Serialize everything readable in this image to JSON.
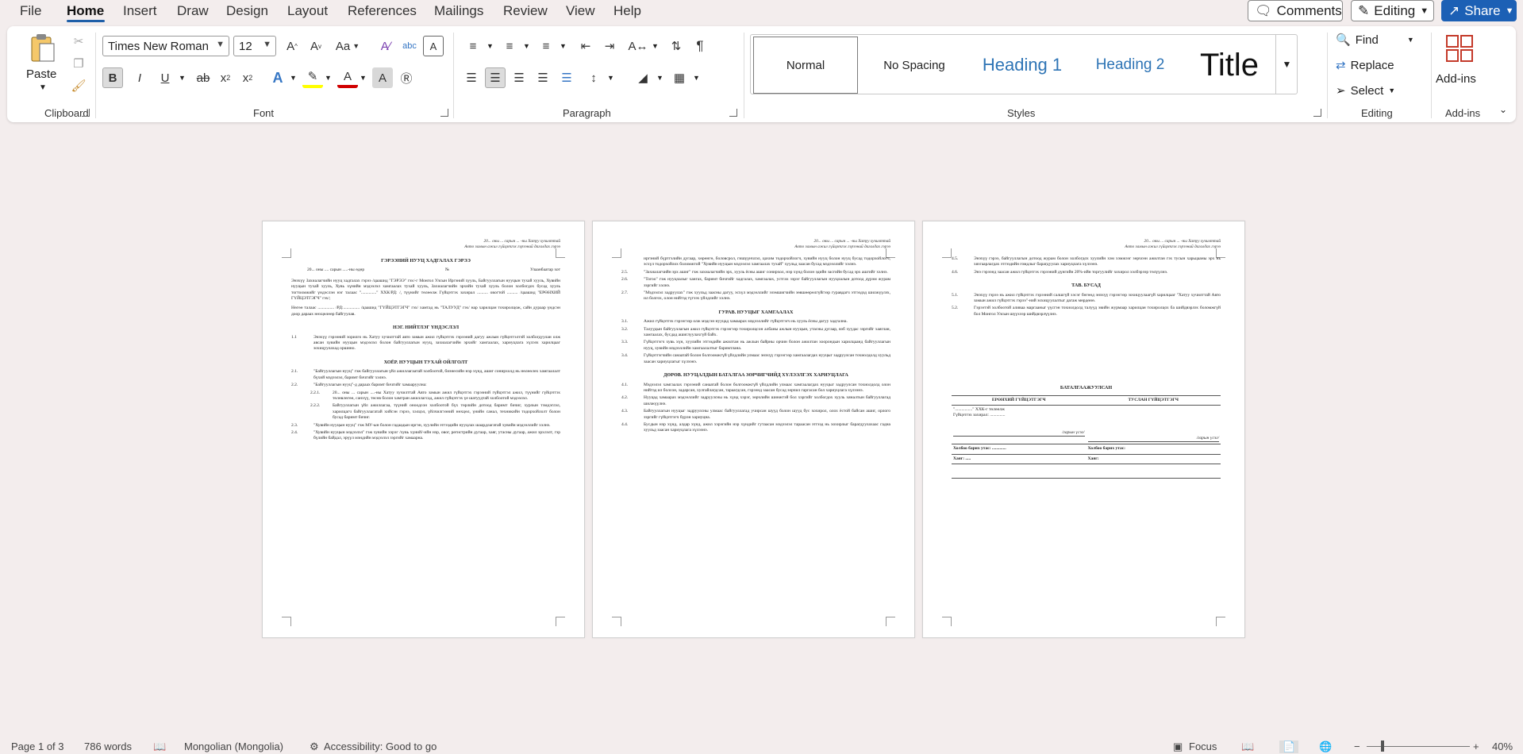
{
  "menu": {
    "items": [
      "File",
      "Home",
      "Insert",
      "Draw",
      "Design",
      "Layout",
      "References",
      "Mailings",
      "Review",
      "View",
      "Help"
    ],
    "active": "Home",
    "comments_label": "Comments",
    "editing_label": "Editing",
    "share_label": "Share"
  },
  "ribbon": {
    "clipboard": {
      "label": "Clipboard",
      "paste_label": "Paste"
    },
    "font": {
      "label": "Font",
      "font_name": "Times New Roman",
      "font_size": "12",
      "case_label": "Aa"
    },
    "paragraph": {
      "label": "Paragraph"
    },
    "styles": {
      "label": "Styles",
      "normal": "Normal",
      "no_spacing": "No Spacing",
      "heading1": "Heading 1",
      "heading2": "Heading 2",
      "title": "Title"
    },
    "editing": {
      "label": "Editing",
      "find": "Find",
      "replace": "Replace",
      "select": "Select"
    },
    "addins": {
      "label": "Add-ins",
      "button": "Add-ins"
    }
  },
  "colors": {
    "accent": "#1c60b5",
    "heading": "#2e74b5",
    "highlight": "#ffff00",
    "font_color": "#d00000"
  },
  "document": {
    "header_line1": "20... оны ... сарын ... -ны Хатуу хучилттай",
    "header_line2": "Авто замын ажил гүйцэтгэх гэрээний дагалдах гэрээ",
    "page1": {
      "title": "ГЭРЭЭНИЙ НУУЦ ХАДГАЛАХ ГЭРЭЭ",
      "date_line": "20... оны .... сарын .....-ны өдөр",
      "number_label": "№",
      "city": "Улаанбаатар хот",
      "p1": "Энэхүү Захиалагчийн нууц хадгалах гэрээ /цаашид \"ГЭРЭЭ\" гэх/-г Монгол Улсын Иргэний хууль, Байгууллагын нууцын тухай хууль, Хувийн нууцын тухай хууль, Хувь хүнийн мэдээлэл хамгаалах тухай хууль, Захиалагчийн эрхийн тухай хууль болон холбогдох бусад хууль тогтоомжийг үндэслэн нэг талаас \"..............\" ХХК/РД: /, түүнийг төлөөлж Гүйцэтгэх захирал .......... овогтой .......... /цаашид \"ЕРӨНХИЙ ГҮЙЦЭТГЭГЧ\" гэх/;",
      "p2": "Нөгөө талаас ............... /РД:............... /цаашид \"ГҮЙЦЭТГЭГЧ\" гэх/ хамтад нь \"ТАЛУУД\" гэх/ нар харилцан тохиролцож, сайн дураар үндсэн доор дараах нөхцөлөөр байгуулав.",
      "s1_title": "НЭГ. НИЙТЛЭГ ҮНДЭСЛЭЛ",
      "s1_1_num": "1.1",
      "s1_1": "Энэхүү гэрээний зорилго нь Хатуу хучилттай авто замын ажил гүйцэтгэх гэрээний дагуу ажлын гүйцэтгэлтэй холбогдуулан олж авсан хувийн нууцын мэдээлэл болон байгууллагын нууц, захиалагчийн эрхийг хамгаалах, хариуцлага хүлээх харилцааг зохицуулахад оршино.",
      "s2_title": "ХОЁР. НУУЦЫН ТУХАЙ ОЙЛГОЛТ",
      "s2_1_num": "2.1.",
      "s2_1": "\"Байгууллагын нууц\" гэж байгууллагын үйл ажиллагаатай холбоотой, бизнесийн нэр хүнд, ашиг сонирхолд нь нөлөөлөх хамгаалалт бүхий мэдээлэл, баримт бичгийг хэлнэ.",
      "s2_2_num": "2.2.",
      "s2_2": "\"Байгууллагын нууц\"-д дараах баримт бичгийг хамааруулна:",
      "s2_2_1_num": "2.2.1.",
      "s2_2_1": "20... оны ... сарын ....-ны Хатуу хучилттай Авто замын ажил гүйцэтгэх гэрээний гүйцэтгэл ажил, түүнийг гүйцэтгэх төлөвлөгөө, санхүү, төсөв болон хамтран ажиллагсад, ажил гүйцэтгэх үе шатуудтай холбоотой мэдээлэл.",
      "s2_2_2_num": "2.2.2.",
      "s2_2_2": "Байгууллагын үйл ажиллагаа, түүний оноодсон холбоотой бүх төрлийн дотоод баримт бичиг, хурлын тэмдэглэл, харилцагч байгууллагатай хийсэн гэрээ, хэлцэл, үйлчилгээний нөхцөл, үнийн санал, техникийн тодорхойлолт болон бусад баримт бичиг.",
      "s2_3_num": "2.3.",
      "s2_3": "\"Хувийн нууцын нууц\" гэж МУ-ын болон гадаадын иргэн, хуулийн этгээдийн нууцлах шаардлагатай хувийн мэдээллийг хэлнэ.",
      "s2_4_num": "2.4.",
      "s2_4": "\"Хувийн нууцын мэдээлэл\" гэж хувийн хэрэг /хувь хүний/-ийн нэр, овог, регистрийн дугаар, хаяг, утасны дугаар, ажил эрхлэлт, гэр бүлийн байдал, эрүүл мэндийн мэдээлэл зэргийг хамаарна."
    },
    "page2": {
      "p_top": "иргэний бүртгэлийн дугаар, хөрөнгө, боловсрол, гишүүнчлэл, цахим тодорхойлогч, хувийн нууц болон нууц бусад тодорхойлогч, эсхүл тодорхойлох боломжтой \"Хувийн нууцын мэдээлэл хамгаалах тухай\" хуульд заасан бусад мэдээллийг хэлнэ.",
      "s2_5_num": "2.5.",
      "s2_5": "\"Захиалагчийн эрх ашиг\" гэж захиалагчийн эрх, хууль ёсны ашиг сонирхол, нэр хүнд болон эдийн засгийн бусад эрх ашгийг хэлнэ.",
      "s2_6_num": "2.6.",
      "s2_6": "\"Тогоо\" гэж нууцлалыг хангах, баримт бичгийг хадгалах, хамгаалах, устгах зэрэг байгууллагын нууцлалын дотоод дүрэм журам зэргийг хэлнэ.",
      "s2_7_num": "2.7.",
      "s2_7": "\"Мэдээлэл задруулах\" гэж хуульд заасны дагуу, эсхүл мэдээллийг эзэмшигчийн зөвшөөрөлгүйгээр гуравдагч этгээдэд шилжүүлэх, ил болгох, олон нийтэд түгээх үйлдлийг хэлнэ.",
      "s3_title": "ГУРАВ. НУУЦЫГ ХАМГААЛАХ",
      "s3_1_num": "3.1.",
      "s3_1": "Ажил гүйцэтгэх гэрээгээр олж мэдсэн нууцад хамаарах мэдээллийг гүйцэтгэгч нь хууль ёсны дагуу хадгална.",
      "s3_2_num": "3.2.",
      "s3_2": "Талуудын байгууллагын ажил гүйцэтгэх гэрээгээр тохиролцсон албаны ажлын нууцын, утасны дугаар, вэб хуудас зэргийг хаяглан, хамгаалах, бусдад ашиглуулахгүй байх.",
      "s3_3_num": "3.3.",
      "s3_3": "Гүйцэтгэгч хувь хүн, хуулийн этгээдийн ажилтан нь ажлын байрны орчин болон ажилтан хоорондын харилцаанд байгууллагын нууц, хувийн мэдээллийн хамгаалалтыг баримтлана.",
      "s3_4_num": "3.4.",
      "s3_4": "Гүйцэтгэгчийн санаатай болон болгоомжгүй үйлдлийн улмаас энэхүү гэрээгээр хамгаалагдах нууцыг задруулсан тохиолдолд хуульд заасан хариуцлагыг хүлээнэ.",
      "s4_title": "ДӨРӨВ. НУУЦАЛДЫН БАТАЛГАА ЗӨРЧИГЧИЙД ХҮЛЭЭЛГЭХ ХАРИУЦЛАГА",
      "s4_1_num": "4.1.",
      "s4_1": "Мэдээлэл хамгаалах гэрээний санаатай болон болгоомжгүй үйлдлийн улмаас хамгаалагдах нууцыг задруулсан тохиолдолд олон нийтэд ил болсон, задарсан, хулгайлагдсан, тараагдсан, гэрээнд заасан бусад зөрчил гаргасан бол хариуцлага хүлээнэ.",
      "s4_2_num": "4.2.",
      "s4_2": "Нууцад хамаарах мэдээллийг задруулсны нь хүнд хэрэг, зөрчлийн шинжтэй бол хэргийг холбогдох хууль хяналтын байгууллагад шилжүүлнэ.",
      "s4_3_num": "4.3.",
      "s4_3": "Байгууллагын нууцыг задруулсны улмаас байгууллагад учирсан шууд болон шууд бус хохирол, олох ёстой байсан ашиг, орлого зэргийг гүйцэтгэгч бүрэн хариуцна.",
      "s4_4_num": "4.4.",
      "s4_4": "Бусдын нэр хүнд, алдар хүнд, ажил хэрэгийн нэр хүндийг гутаасан мэдээлэл тараасан этгээд нь хохирлыг барагдуулахаас гадна хуульд заасан хариуцлага хүлээнэ."
    },
    "page3": {
      "s4_5_num": "4.5.",
      "s4_5": "Энэхүү гэрээ, байгууллагын дотоод журам болон холбогдох хуулийн хэм хэмжээг зөрчсөн ажилтан гэх тусын харьцааны эрх нь хязгаарлагдах этгээдийн гомдлыг барагдуулах хариуцлага хүлээнэ.",
      "s4_6_num": "4.6.",
      "s4_6": "Энэ гэрээнд заасан ажил гүйцэтгэх гэрээний дүнгийн 20%-ийн торгуулийг хохирол хэлбэрээр төлүүлнэ.",
      "s5_title": "ТАВ. БУСАД",
      "s5_1_num": "5.1.",
      "s5_1": "Энэхүү гэрээ нь ажил гүйцэтгэх гэрээний салшгүй хэсэг бөгөөд энэхүү гэрээгээр зохицуулаагүй харилцааг \"Хатуу хучилттай Авто замын ажил гүйцэтгэх гэрээ\"-ний зохицуулалтыг дагаж мөрдөнө.",
      "s5_2_num": "5.2.",
      "s5_2": "Гэрээтэй холбоотой аливаа маргааныг үүсгэн тохиолдолд талууд эвийн журмаар харилцан тохиролцох ба шийдвэрлэх боломжгүй бол Монгол Улсын шүүхээр шийдвэрлүүлнэ.",
      "sig_title": "БАТАЛГААЖУУЛСАН",
      "general_contractor": "ЕРӨНХИЙ ГҮЙЦЭТГЭГЧ",
      "contractor": "ТУСЛАН ГҮЙЦЭТГЭГЧ",
      "company_line": "\"................\" ХХК-г төлөөлж",
      "director_line": "Гүйцэтгэх захирал: ..............",
      "signature": "/гарын үсэг/",
      "phone": "Холбоо барих утас: .............",
      "phone2": "Холбоо барих утас:",
      "address": "Хаяг: .....",
      "address2": "Хаяг:"
    }
  },
  "status": {
    "page": "Page 1 of 3",
    "words": "786 words",
    "language": "Mongolian (Mongolia)",
    "accessibility": "Accessibility: Good to go",
    "focus": "Focus",
    "zoom": "40%"
  }
}
